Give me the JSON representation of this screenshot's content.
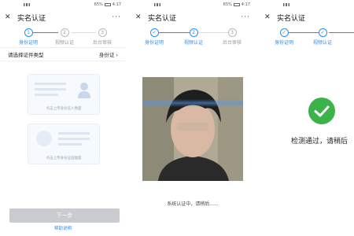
{
  "status": {
    "time": "4:17",
    "battery": "65%"
  },
  "header": {
    "close_icon": "close-icon",
    "title": "实名认证",
    "more": "···"
  },
  "steps": {
    "one": "1",
    "two": "2",
    "three": "3",
    "labels": [
      "身份证明",
      "视频认证",
      "后台审核"
    ]
  },
  "screen1": {
    "doc_type_label": "请选择证件类型",
    "doc_type_value": "身份证",
    "card_front_caption": "点击上传身份证人像面",
    "card_back_caption": "点击上传身份证国徽面",
    "next_button": "下一步",
    "help_link": "帮助说明"
  },
  "screen2": {
    "recognizing_text": "系统认证中，请稍后......"
  },
  "screen3": {
    "result_text": "检测通过，请稍后"
  },
  "colors": {
    "accent": "#2b8ef0",
    "success": "#3cb24a",
    "button_disabled": "#c9cbcf"
  }
}
